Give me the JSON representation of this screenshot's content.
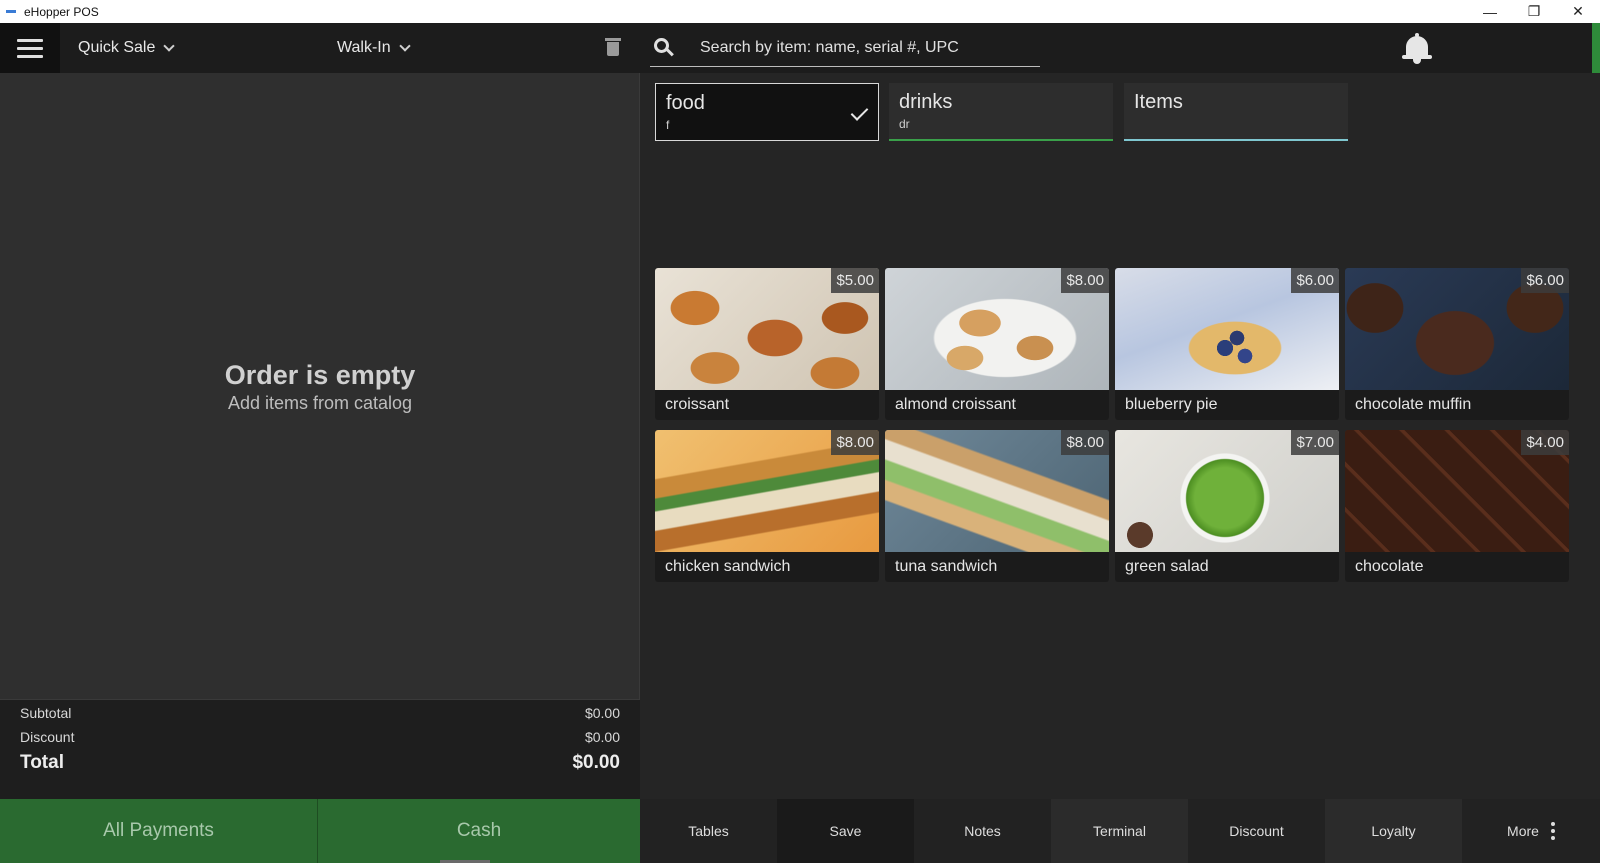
{
  "window": {
    "title": "eHopper POS",
    "minimize": "—",
    "restore": "❐",
    "close": "✕"
  },
  "order_header": {
    "sale_type": "Quick Sale",
    "customer": "Walk-In"
  },
  "order": {
    "empty_title": "Order is empty",
    "empty_subtitle": "Add items from catalog"
  },
  "totals": {
    "subtotal_label": "Subtotal",
    "subtotal_value": "$0.00",
    "discount_label": "Discount",
    "discount_value": "$0.00",
    "total_label": "Total",
    "total_value": "$0.00"
  },
  "payments": {
    "all_payments": "All Payments",
    "cash": "Cash"
  },
  "search": {
    "placeholder": "Search by item: name, serial #, UPC"
  },
  "categories": [
    {
      "name": "food",
      "abbr": "f",
      "selected": true
    },
    {
      "name": "drinks",
      "abbr": "dr",
      "selected": false
    },
    {
      "name": "Items",
      "abbr": "",
      "selected": false
    }
  ],
  "items": [
    {
      "name": "croissant",
      "price": "$5.00"
    },
    {
      "name": "almond croissant",
      "price": "$8.00"
    },
    {
      "name": "blueberry pie",
      "price": "$6.00"
    },
    {
      "name": "chocolate muffin",
      "price": "$6.00"
    },
    {
      "name": "chicken sandwich",
      "price": "$8.00"
    },
    {
      "name": "tuna sandwich",
      "price": "$8.00"
    },
    {
      "name": "green salad",
      "price": "$7.00"
    },
    {
      "name": "chocolate",
      "price": "$4.00"
    }
  ],
  "actions": [
    "Tables",
    "Save",
    "Notes",
    "Terminal",
    "Discount",
    "Loyalty",
    "More"
  ],
  "icons": [
    "menu-icon",
    "chevron-down-icon",
    "trash-icon",
    "search-icon",
    "bell-icon",
    "checkmark-icon",
    "more-vertical-icon"
  ],
  "colors": {
    "accent_green": "#2a6a30",
    "tab_green": "#3aa04a",
    "tab_blue": "#7fc7d0"
  }
}
